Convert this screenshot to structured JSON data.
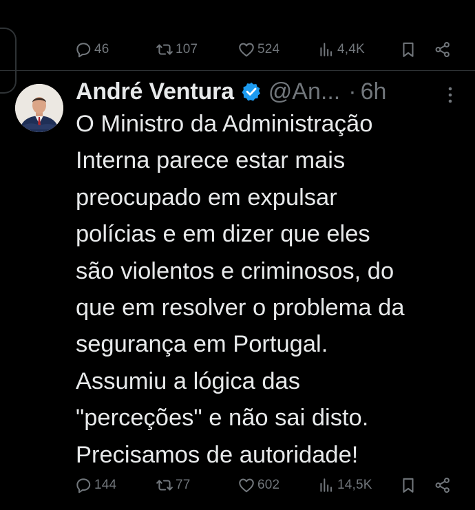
{
  "previous_tweet_actions": {
    "replies": "46",
    "retweets": "107",
    "likes": "524",
    "views": "4,4K"
  },
  "tweet": {
    "author_name": "André Ventura",
    "handle": "@An...",
    "separator": "·",
    "time": "6h",
    "verified": true,
    "text": "O Ministro da Administração\nInterna parece estar mais\npreocupado em expulsar\npolícias e em dizer que eles\nsão violentos e criminosos, do\nque em resolver o problema da\nsegurança em Portugal.\nAssumiu a lógica das\n\"perceções\" e não sai disto.\nPrecisamos de autoridade!",
    "actions": {
      "replies": "144",
      "retweets": "77",
      "likes": "602",
      "views": "14,5K"
    }
  },
  "icons": {
    "reply": "reply-icon",
    "retweet": "retweet-icon",
    "like": "heart-icon",
    "views": "views-icon",
    "bookmark": "bookmark-icon",
    "share": "share-icon",
    "more": "more-vertical-icon",
    "verified": "verified-badge-icon"
  },
  "colors": {
    "background": "#000000",
    "text": "#e7e9ea",
    "muted": "#71767b",
    "divider": "#2f3336",
    "verified": "#1d9bf0"
  }
}
